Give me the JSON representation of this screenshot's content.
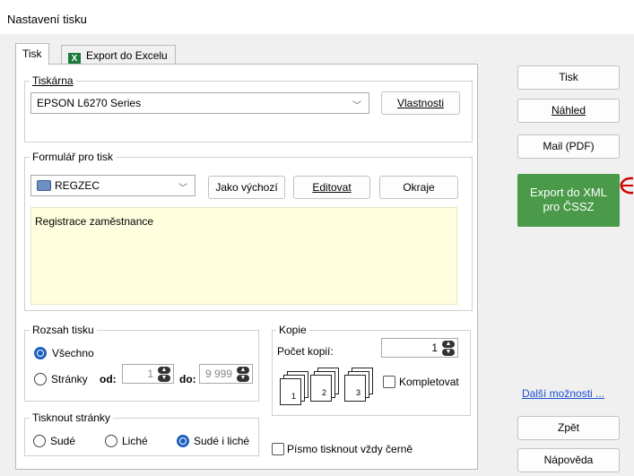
{
  "window": {
    "title": "Nastavení tisku"
  },
  "tabs": [
    {
      "label": "Tisk"
    },
    {
      "label": "Export do Excelu"
    }
  ],
  "printer_group": {
    "title": "Tiskárna",
    "selected": "EPSON L6270 Series",
    "properties_button": "Vlastnosti"
  },
  "form_group": {
    "title": "Formulář pro tisk",
    "selected": "REGZEC",
    "default_button": "Jako výchozí",
    "edit_button": "Editovat",
    "margins_button": "Okraje",
    "description": "Registrace zaměstnance"
  },
  "range_group": {
    "title": "Rozsah tisku",
    "all_label": "Všechno",
    "pages_label": "Stránky",
    "from_label": "od:",
    "from_value": "1",
    "to_label": "do:",
    "to_value": "9 999"
  },
  "print_pages_group": {
    "title": "Tisknout stránky",
    "even": "Sudé",
    "odd": "Liché",
    "both": "Sudé i liché"
  },
  "copies_group": {
    "title": "Kopie",
    "count_label": "Počet kopií:",
    "count_value": "1",
    "collate_label": "Kompletovat"
  },
  "black_font_label": "Písmo tisknout vždy černě",
  "right_buttons": {
    "print": "Tisk",
    "preview": "Náhled",
    "mail": "Mail (PDF)",
    "export_xml_line1": "Export do XML",
    "export_xml_line2": "pro ČSSZ",
    "more_options": "Další možnosti ...",
    "back": "Zpět",
    "help": "Nápověda"
  },
  "colors": {
    "export_green": "#4a9a4a",
    "radio_blue": "#1e5fc0",
    "note_bg": "#ffffe0"
  }
}
